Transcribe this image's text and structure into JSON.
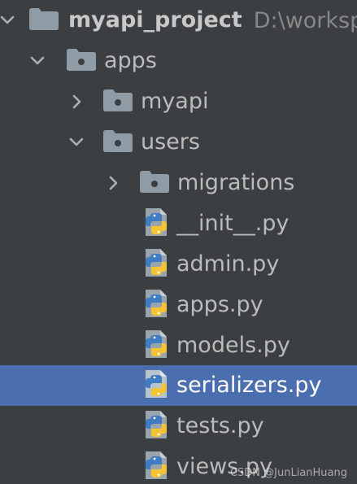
{
  "project_tree": {
    "root": {
      "name": "myapi_project",
      "path": "D:\\worksp",
      "expanded": true
    },
    "apps": {
      "name": "apps",
      "expanded": true
    },
    "myapi": {
      "name": "myapi",
      "expanded": false
    },
    "users": {
      "name": "users",
      "expanded": true
    },
    "migrations": {
      "name": "migrations",
      "expanded": false
    },
    "files": [
      {
        "name": "__init__.py",
        "selected": false
      },
      {
        "name": "admin.py",
        "selected": false
      },
      {
        "name": "apps.py",
        "selected": false
      },
      {
        "name": "models.py",
        "selected": false
      },
      {
        "name": "serializers.py",
        "selected": true
      },
      {
        "name": "tests.py",
        "selected": false
      },
      {
        "name": "views.py",
        "selected": false
      }
    ]
  },
  "watermark": "CSDN @JunLianHuang",
  "colors": {
    "background": "#3c3f41",
    "selection": "#4b6eaf",
    "text": "#bbbbbb",
    "folder_icon": "#8f9ba5",
    "python_blue": "#3f7cc2",
    "python_yellow": "#f5c434"
  }
}
